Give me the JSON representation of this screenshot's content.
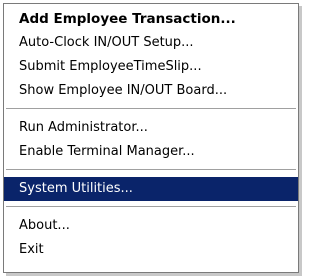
{
  "menu": {
    "items": [
      {
        "label": "Add Employee Transaction..."
      },
      {
        "label": "Auto-Clock IN/OUT Setup..."
      },
      {
        "label": "Submit EmployeeTimeSlip..."
      },
      {
        "label": "Show Employee IN/OUT Board..."
      },
      {
        "label": "Run Administrator..."
      },
      {
        "label": "Enable Terminal Manager..."
      },
      {
        "label": "System Utilities..."
      },
      {
        "label": "About..."
      },
      {
        "label": "Exit"
      }
    ],
    "default_item": "Add Employee Transaction...",
    "highlighted_item": "System Utilities...",
    "highlight_color": "#0a246a"
  }
}
